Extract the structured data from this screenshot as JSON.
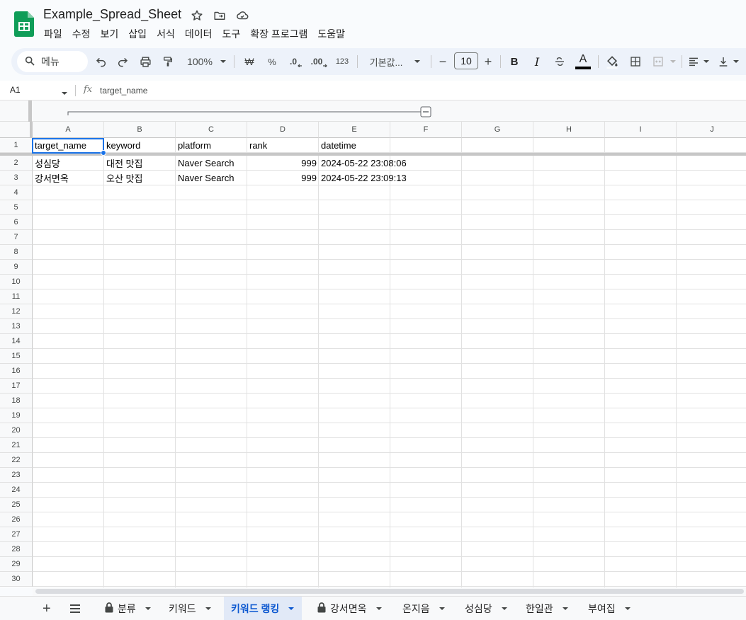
{
  "document": {
    "title": "Example_Spread_Sheet"
  },
  "menu": [
    "파일",
    "수정",
    "보기",
    "삽입",
    "서식",
    "데이터",
    "도구",
    "확장 프로그램",
    "도움말"
  ],
  "toolbar": {
    "search_label": "메뉴",
    "zoom": "100%",
    "currency": "₩",
    "percent": "%",
    "decimal_decrease": ".0",
    "decimal_increase": ".00",
    "number_format": "123",
    "font": "기본값...",
    "font_size": "10",
    "bold": "B",
    "italic": "I",
    "text_color": "A"
  },
  "formula_bar": {
    "cell_ref": "A1",
    "fx": "fx",
    "value": "target_name"
  },
  "grid": {
    "columns": [
      "A",
      "B",
      "C",
      "D",
      "E",
      "F",
      "G",
      "H",
      "I",
      "J"
    ],
    "rows": [
      "1",
      "2",
      "3",
      "4",
      "5",
      "6",
      "7",
      "8",
      "9",
      "10",
      "11",
      "12",
      "13",
      "14",
      "15",
      "16",
      "17",
      "18",
      "19",
      "20",
      "21",
      "22",
      "23",
      "24",
      "25",
      "26",
      "27",
      "28",
      "29",
      "30"
    ],
    "header": [
      "target_name",
      "keyword",
      "platform",
      "rank",
      "datetime"
    ],
    "data": [
      [
        "성심당",
        "대전 맛집",
        "Naver Search",
        "999",
        "2024-05-22 23:08:06"
      ],
      [
        "강서면옥",
        "오산 맛집",
        "Naver Search",
        "999",
        "2024-05-22 23:09:13"
      ]
    ]
  },
  "sheets": [
    {
      "label": "분류",
      "locked": true,
      "active": false
    },
    {
      "label": "키워드",
      "locked": false,
      "active": false
    },
    {
      "label": "키워드 랭킹",
      "locked": false,
      "active": true
    },
    {
      "label": "강서면옥",
      "locked": true,
      "active": false
    },
    {
      "label": "온지음",
      "locked": false,
      "active": false
    },
    {
      "label": "성심당",
      "locked": false,
      "active": false
    },
    {
      "label": "한일관",
      "locked": false,
      "active": false
    },
    {
      "label": "부여집",
      "locked": false,
      "active": false
    }
  ],
  "colors": {
    "accent": "#1a73e8",
    "brand_green": "#0f9d58",
    "active_tab": "#0b57d0"
  }
}
